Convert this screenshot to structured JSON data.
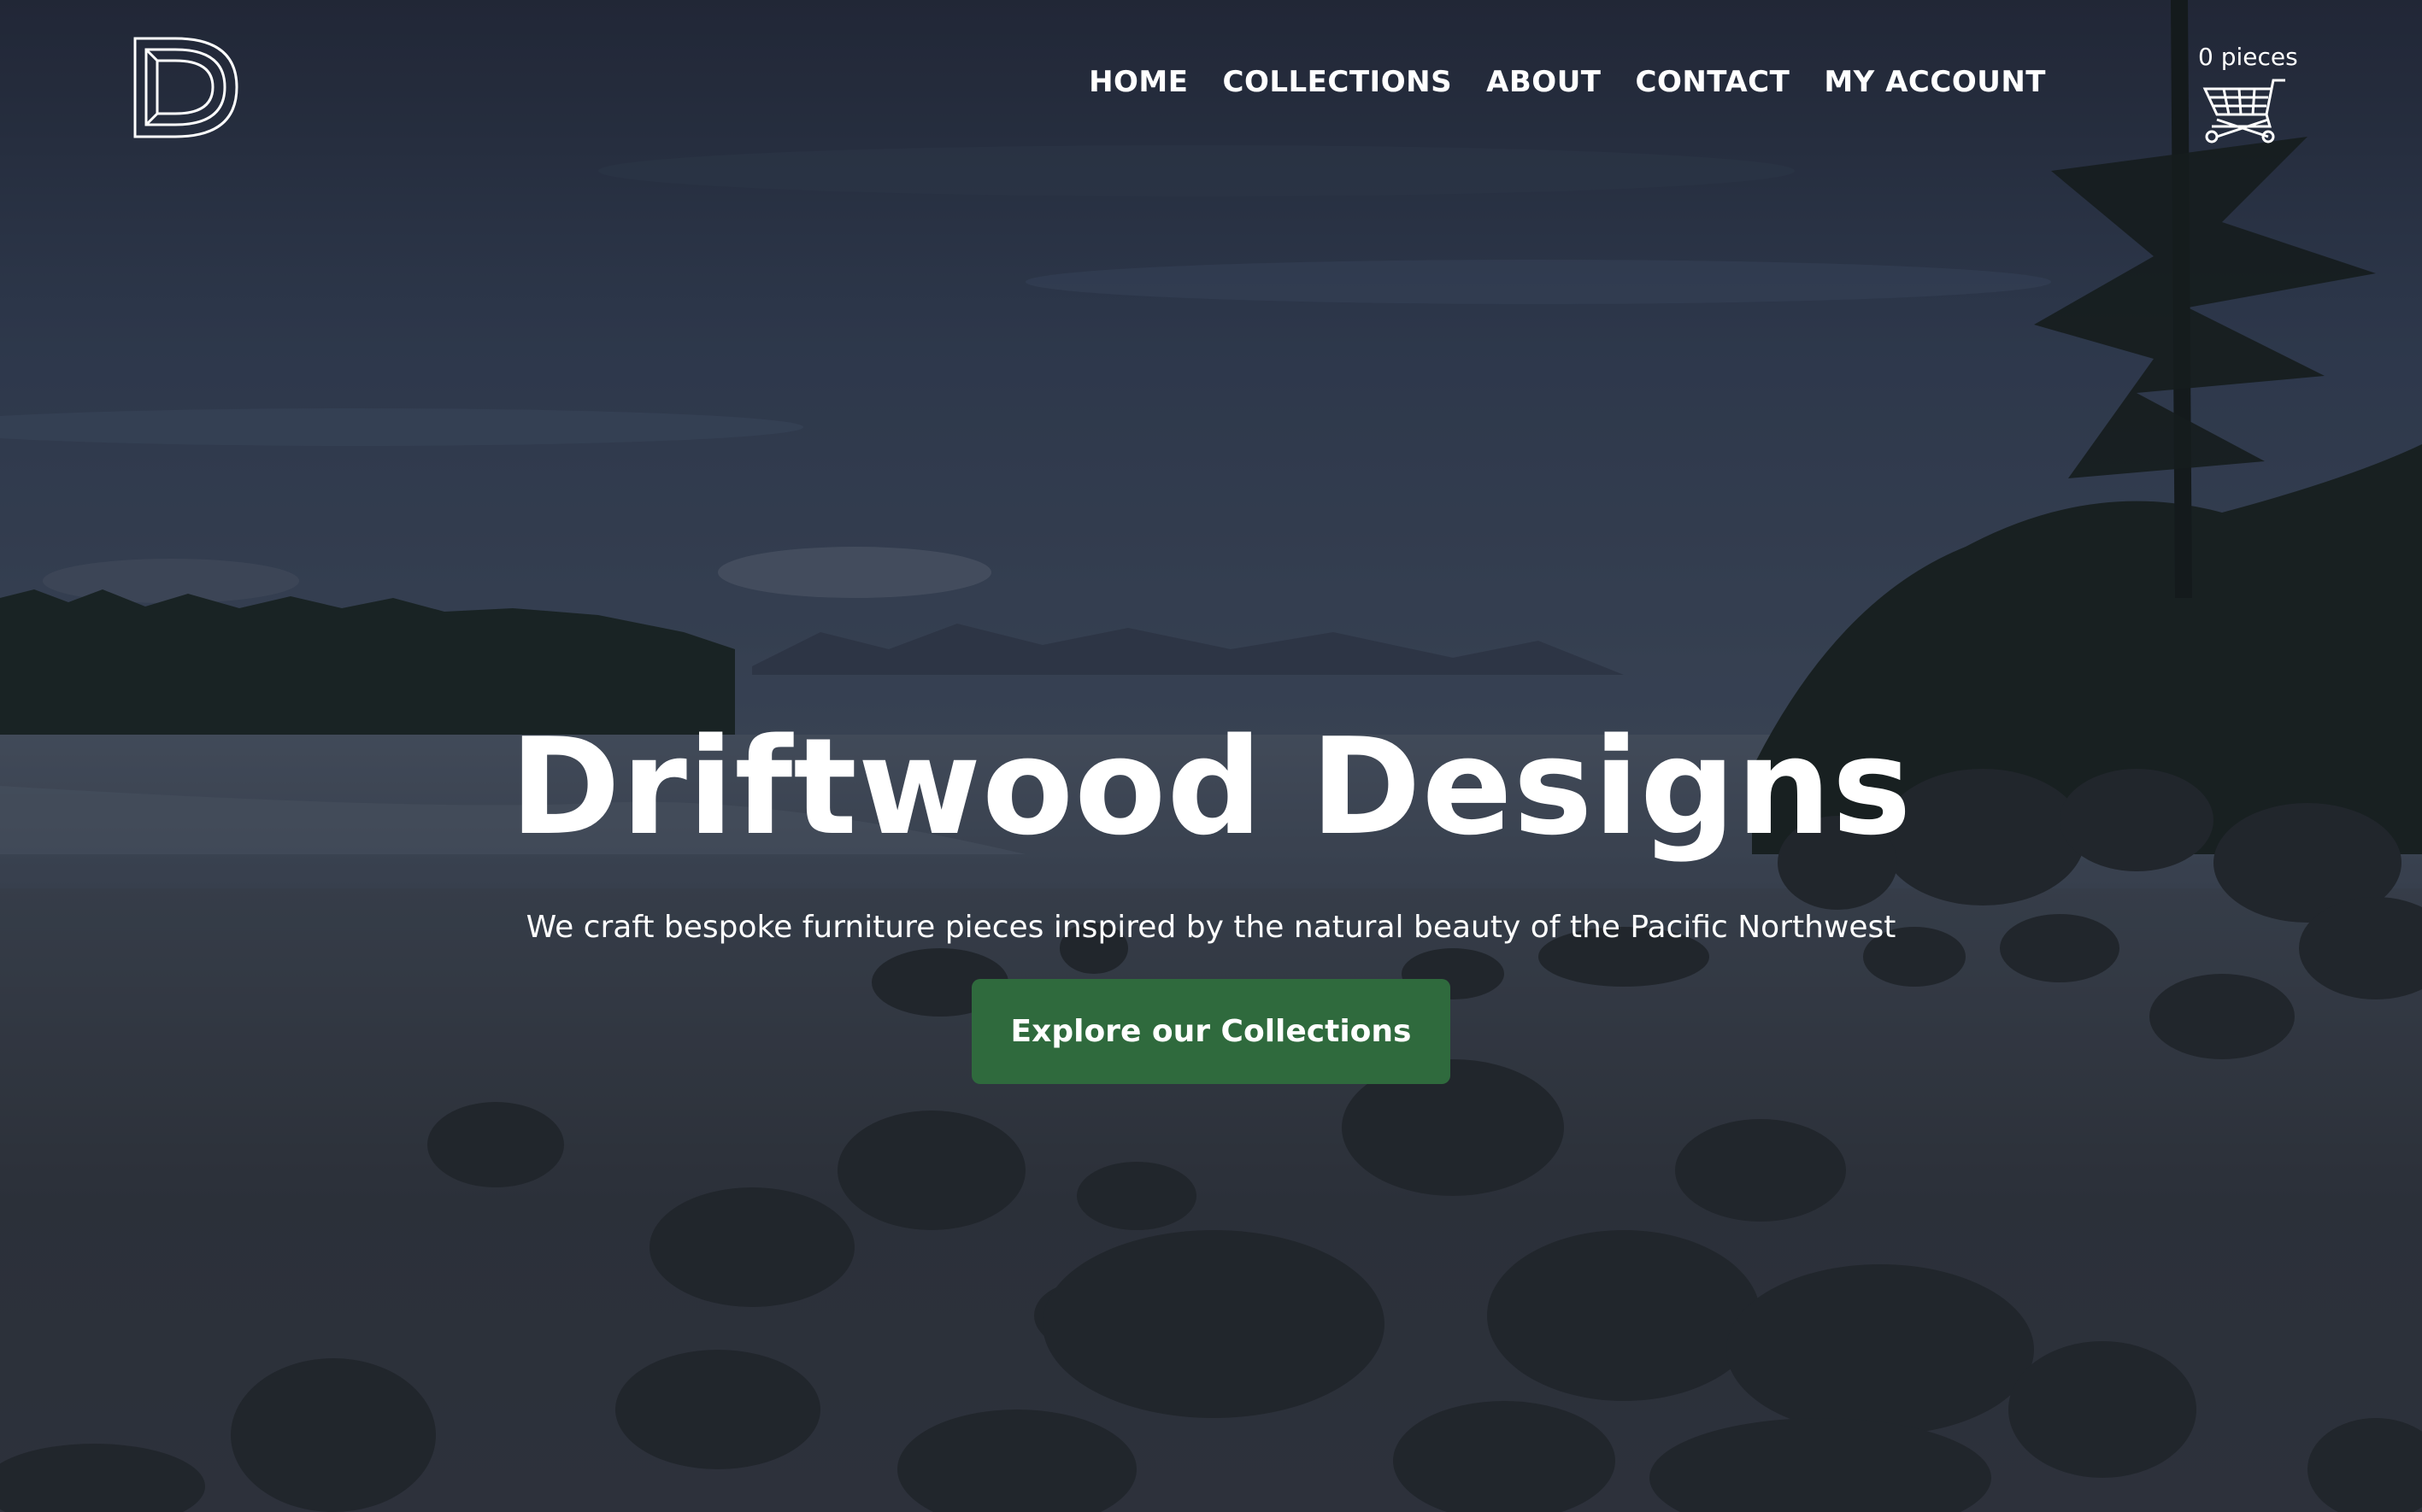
{
  "brand": {
    "logo_icon": "driftwood-d-logo-icon"
  },
  "nav": {
    "items": [
      {
        "label": "HOME"
      },
      {
        "label": "COLLECTIONS"
      },
      {
        "label": "ABOUT"
      },
      {
        "label": "CONTACT"
      },
      {
        "label": "MY ACCOUNT"
      }
    ]
  },
  "cart": {
    "count_label": "0 pieces",
    "icon": "shopping-cart-icon"
  },
  "hero": {
    "title": "Driftwood Designs",
    "tagline": "We craft bespoke furniture pieces inspired by the natural beauty of the Pacific Northwest",
    "cta_label": "Explore our Collections",
    "background": "pacific-northwest-beach-photo"
  },
  "colors": {
    "accent": "#2f6a3d",
    "text": "#ffffff",
    "overlay": "#1c2330"
  }
}
